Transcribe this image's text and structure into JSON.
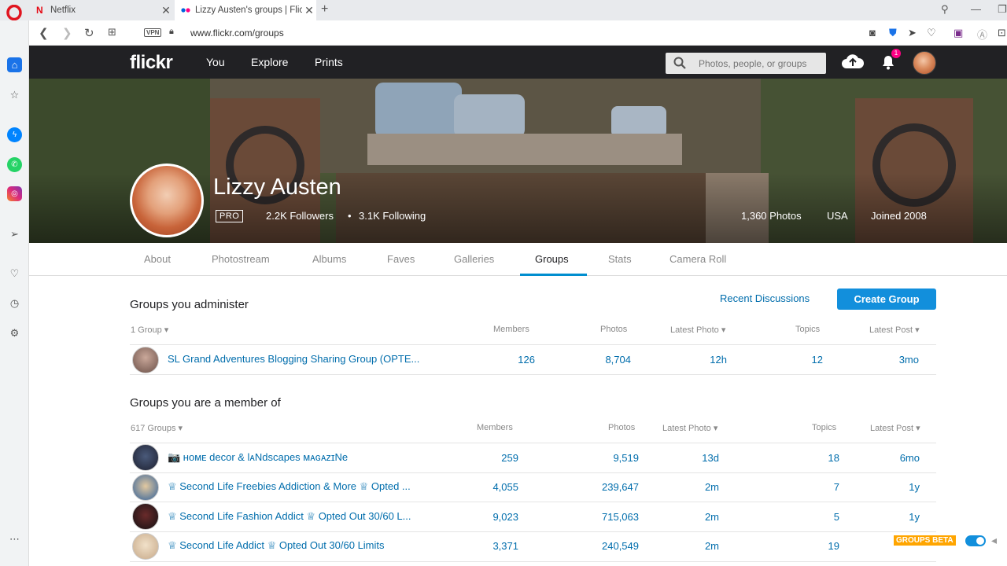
{
  "browser": {
    "tabs": [
      {
        "title": "Netflix"
      },
      {
        "title": "Lizzy Austen's groups | Flickr"
      }
    ],
    "url": "www.flickr.com/groups",
    "vpn_label": "VPN"
  },
  "flickr_nav": {
    "logo": "flickr",
    "links": [
      "You",
      "Explore",
      "Prints"
    ],
    "search_placeholder": "Photos, people, or groups",
    "notification_count": "1"
  },
  "profile": {
    "name": "Lizzy Austen",
    "badge": "PRO",
    "followers": "2.2K Followers",
    "separator": "•",
    "following": "3.1K Following",
    "photos": "1,360 Photos",
    "location": "USA",
    "joined": "Joined 2008"
  },
  "subnav": {
    "tabs": [
      "About",
      "Photostream",
      "Albums",
      "Faves",
      "Galleries",
      "Groups",
      "Stats",
      "Camera Roll"
    ],
    "active": "Groups"
  },
  "admin_section": {
    "title": "Groups you administer",
    "recent_link": "Recent Discussions",
    "create_button": "Create Group",
    "headers": {
      "count": "1 Group ▾",
      "members": "Members",
      "photos": "Photos",
      "latest_photo": "Latest Photo ▾",
      "topics": "Topics",
      "latest_post": "Latest Post ▾"
    },
    "rows": [
      {
        "name": "SL Grand Adventures Blogging Sharing Group (OPTE...",
        "members": "126",
        "photos": "8,704",
        "latest_photo": "12h",
        "topics": "12",
        "latest_post": "3mo"
      }
    ]
  },
  "member_section": {
    "title": "Groups you are a member of",
    "headers": {
      "count": "617 Groups ▾",
      "members": "Members",
      "photos": "Photos",
      "latest_photo": "Latest Photo ▾",
      "topics": "Topics",
      "latest_post": "Latest Post ▾"
    },
    "rows": [
      {
        "name": "📷 ʜᴏᴍᴇ decor & lᴀNdscapes ᴍᴀɢᴀzɪNe",
        "members": "259",
        "photos": "9,519",
        "latest_photo": "13d",
        "topics": "18",
        "latest_post": "6mo"
      },
      {
        "name": "♕ Second Life Freebies Addiction & More ♕ Opted ...",
        "members": "4,055",
        "photos": "239,647",
        "latest_photo": "2m",
        "topics": "7",
        "latest_post": "1y"
      },
      {
        "name": "♕ Second Life Fashion Addict ♕ Opted Out 30/60 L...",
        "members": "9,023",
        "photos": "715,063",
        "latest_photo": "2m",
        "topics": "5",
        "latest_post": "1y"
      },
      {
        "name": "♕ Second Life Addict ♕ Opted Out 30/60 Limits",
        "members": "3,371",
        "photos": "240,549",
        "latest_photo": "2m",
        "topics": "19",
        "latest_post": ""
      }
    ]
  },
  "groups_beta": {
    "label": "GROUPS BETA"
  },
  "colors": {
    "link": "#006dac",
    "accent": "#128fdc",
    "nav_bg": "#212124",
    "badge": "#ff0084",
    "beta": "#ffa500"
  }
}
